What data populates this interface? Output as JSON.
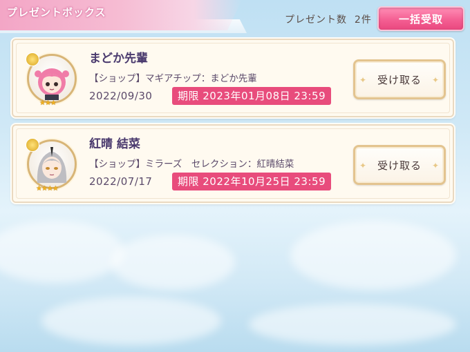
{
  "header": {
    "title": "プレゼントボックス",
    "present_count_label": "プレゼント数",
    "present_count_value": "2件",
    "bulk_receive_label": "一括受取"
  },
  "presents": [
    {
      "name": "まどか先輩",
      "description": "【ショップ】マギアチップ：まどか先輩",
      "date": "2022/09/30",
      "deadline": "期限 2023年01月08日 23:59",
      "receive_label": "受け取る",
      "stars": 3,
      "hair_color": "#f07ca8",
      "avatar_icon": "chibi-pink-hair-icon"
    },
    {
      "name": "紅晴 結菜",
      "description": "【ショップ】ミラーズ　セレクション：紅晴結菜",
      "date": "2022/07/17",
      "deadline": "期限 2022年10月25日 23:59",
      "receive_label": "受け取る",
      "stars": 4,
      "hair_color": "#bdbdc2",
      "avatar_icon": "character-gray-hair-icon"
    }
  ],
  "colors": {
    "accent_pink": "#e84c7c",
    "text_purple": "#4a3a6e",
    "gold_border": "#e3c48f"
  }
}
